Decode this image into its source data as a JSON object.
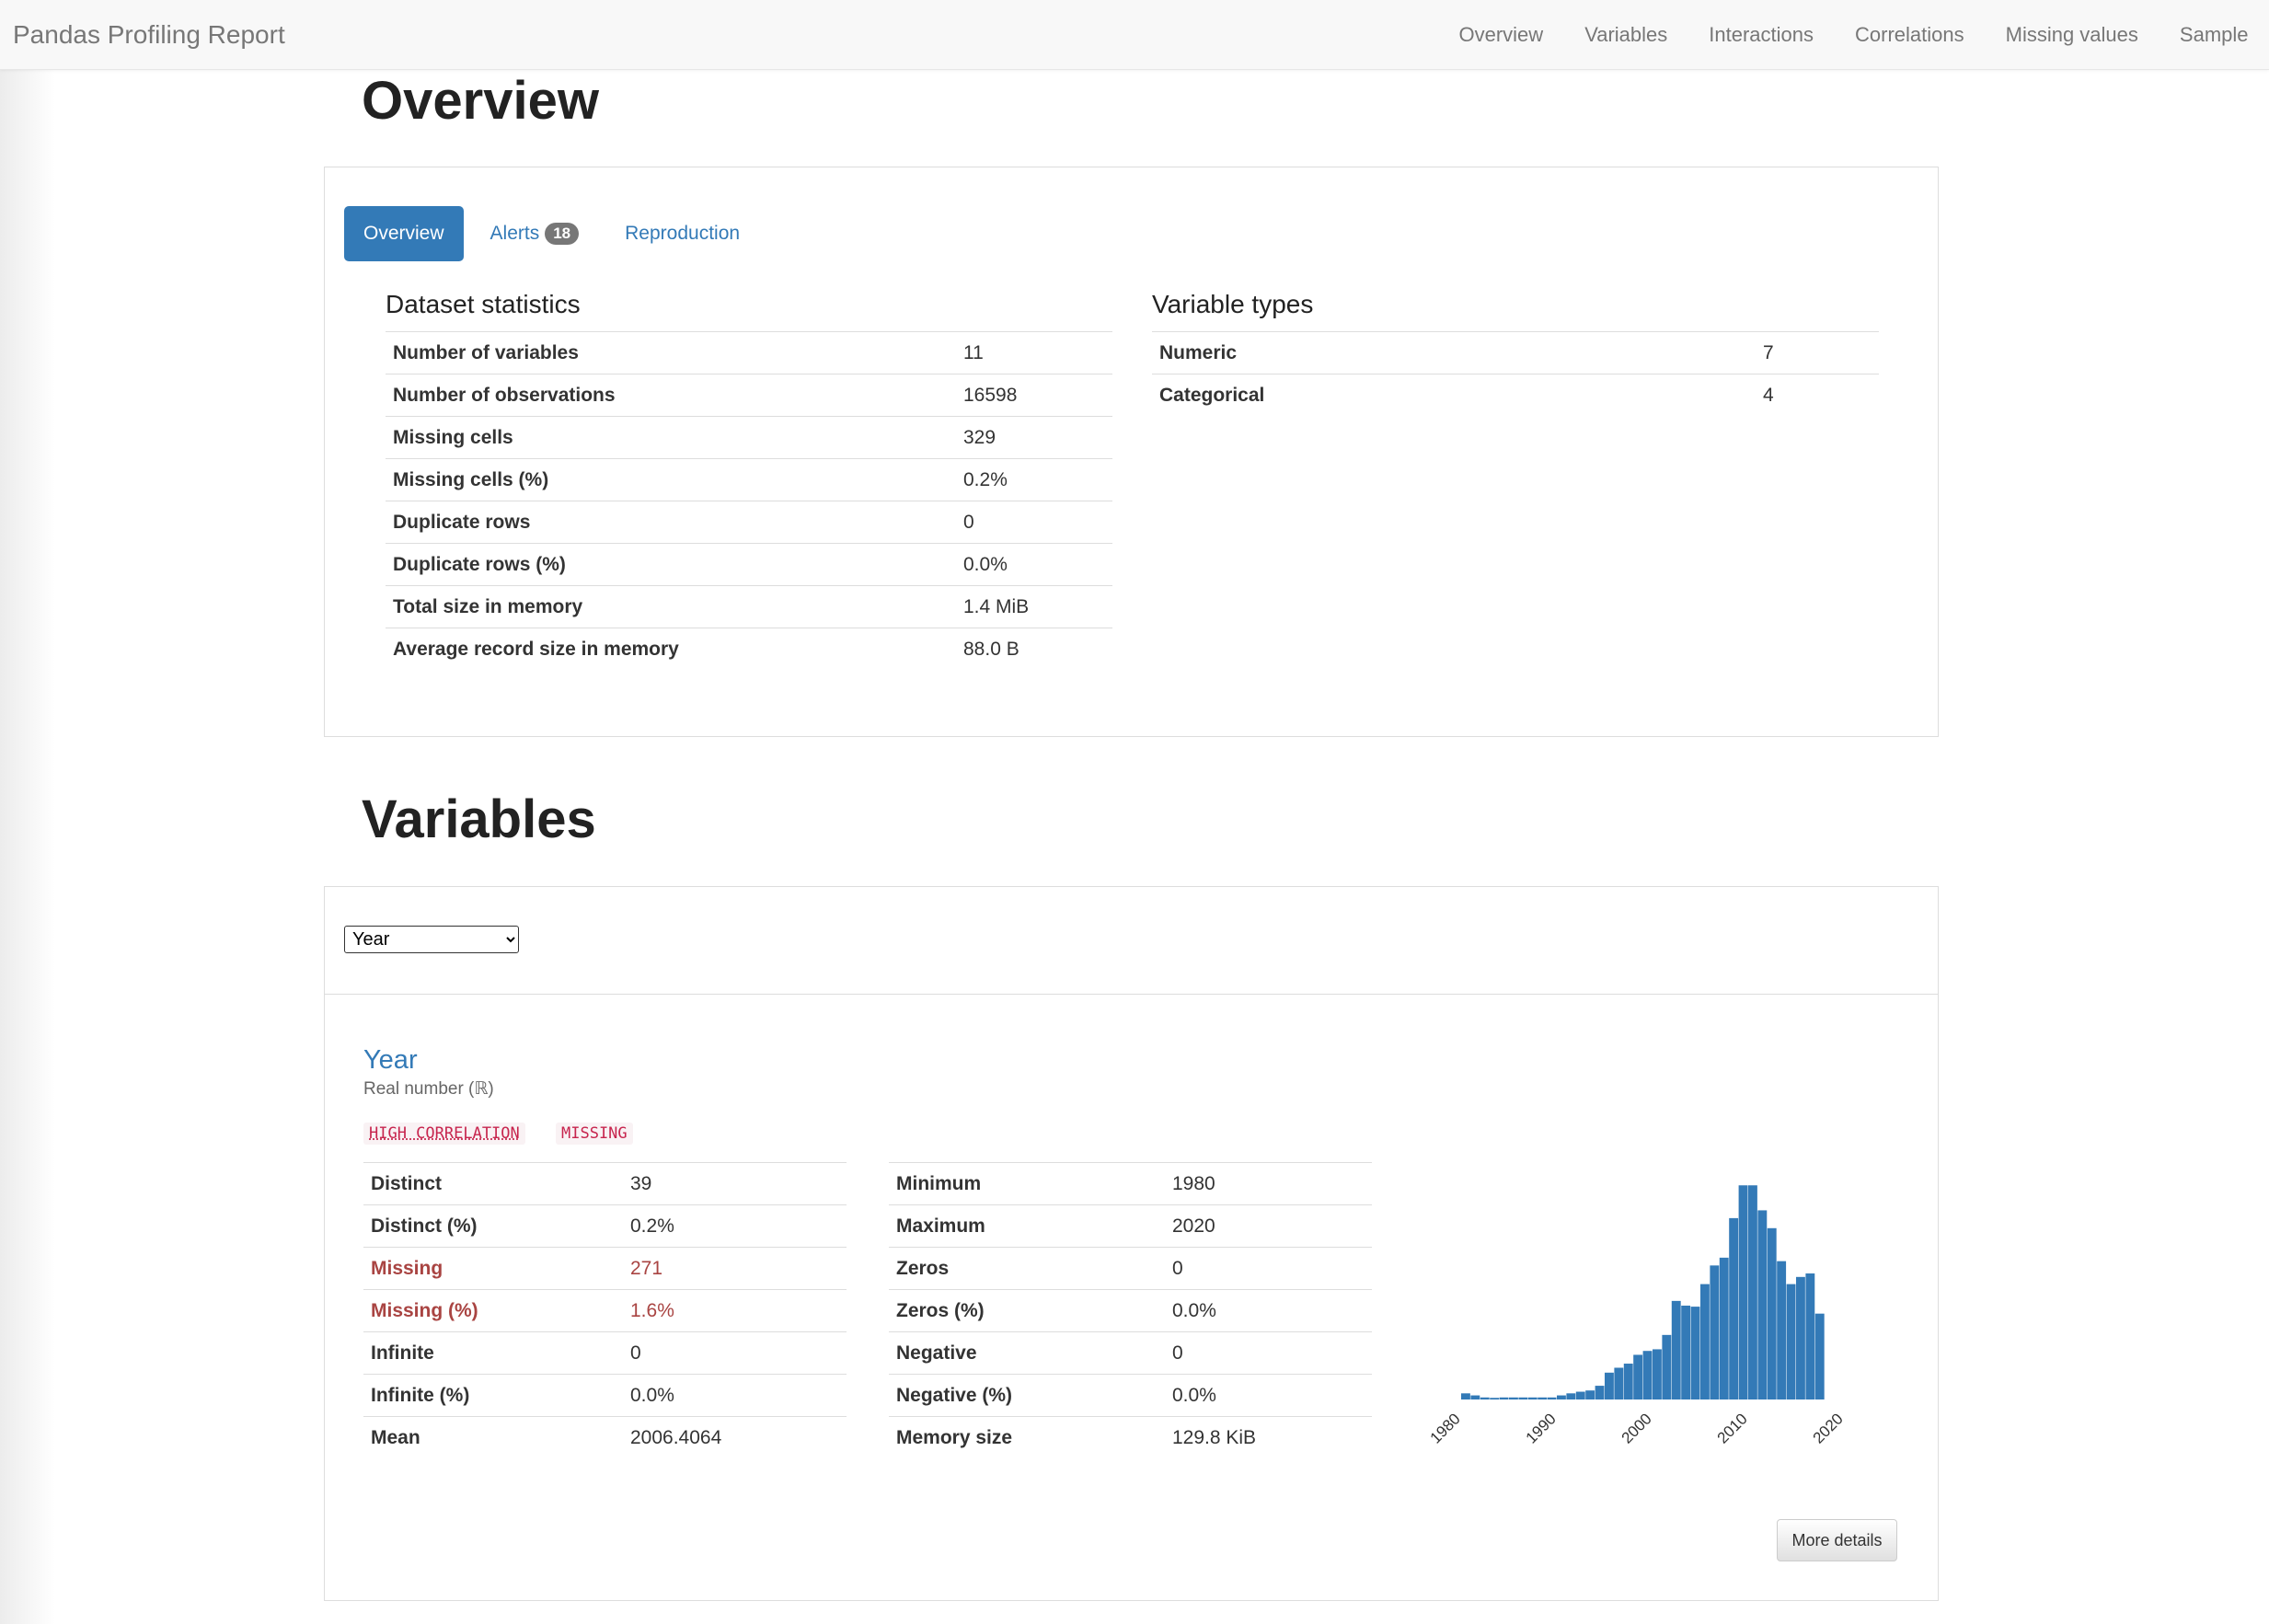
{
  "navbar": {
    "brand": "Pandas Profiling Report",
    "links": [
      "Overview",
      "Variables",
      "Interactions",
      "Correlations",
      "Missing values",
      "Sample"
    ]
  },
  "overview": {
    "heading": "Overview",
    "tabs": {
      "overview": "Overview",
      "alerts": "Alerts",
      "alerts_count": "18",
      "reproduction": "Reproduction"
    },
    "dataset_statistics": {
      "title": "Dataset statistics",
      "rows": [
        {
          "label": "Number of variables",
          "value": "11"
        },
        {
          "label": "Number of observations",
          "value": "16598"
        },
        {
          "label": "Missing cells",
          "value": "329"
        },
        {
          "label": "Missing cells (%)",
          "value": "0.2%"
        },
        {
          "label": "Duplicate rows",
          "value": "0"
        },
        {
          "label": "Duplicate rows (%)",
          "value": "0.0%"
        },
        {
          "label": "Total size in memory",
          "value": "1.4 MiB"
        },
        {
          "label": "Average record size in memory",
          "value": "88.0 B"
        }
      ]
    },
    "variable_types": {
      "title": "Variable types",
      "rows": [
        {
          "label": "Numeric",
          "value": "7"
        },
        {
          "label": "Categorical",
          "value": "4"
        }
      ]
    }
  },
  "variables": {
    "heading": "Variables",
    "select_value": "Year",
    "variable": {
      "name": "Year",
      "type": "Real number (ℝ)",
      "tags": [
        "HIGH CORRELATION",
        "MISSING"
      ],
      "left_table": [
        {
          "label": "Distinct",
          "value": "39"
        },
        {
          "label": "Distinct (%)",
          "value": "0.2%"
        },
        {
          "label": "Missing",
          "value": "271",
          "warn": true
        },
        {
          "label": "Missing (%)",
          "value": "1.6%",
          "warn": true
        },
        {
          "label": "Infinite",
          "value": "0"
        },
        {
          "label": "Infinite (%)",
          "value": "0.0%"
        },
        {
          "label": "Mean",
          "value": "2006.4064"
        }
      ],
      "right_table": [
        {
          "label": "Minimum",
          "value": "1980"
        },
        {
          "label": "Maximum",
          "value": "2020"
        },
        {
          "label": "Zeros",
          "value": "0"
        },
        {
          "label": "Zeros (%)",
          "value": "0.0%"
        },
        {
          "label": "Negative",
          "value": "0"
        },
        {
          "label": "Negative (%)",
          "value": "0.0%"
        },
        {
          "label": "Memory size",
          "value": "129.8 KiB"
        }
      ],
      "more_details": "More details"
    }
  },
  "chart_data": {
    "type": "bar",
    "title": "",
    "xlabel": "",
    "ylabel": "",
    "color": "#337ab7",
    "xlim": [
      1980,
      2020
    ],
    "xticks": [
      "1980",
      "1990",
      "2000",
      "2010",
      "2020"
    ],
    "grid": false,
    "bins_start": 1980,
    "bin_width": 0.9,
    "values": [
      30,
      20,
      10,
      8,
      10,
      10,
      10,
      10,
      10,
      10,
      20,
      30,
      38,
      44,
      67,
      131,
      155,
      175,
      218,
      237,
      245,
      315,
      481,
      458,
      453,
      563,
      654,
      692,
      885,
      1045,
      1045,
      923,
      836,
      675,
      563,
      598,
      615,
      419
    ],
    "ylim": [
      0,
      1100
    ]
  }
}
